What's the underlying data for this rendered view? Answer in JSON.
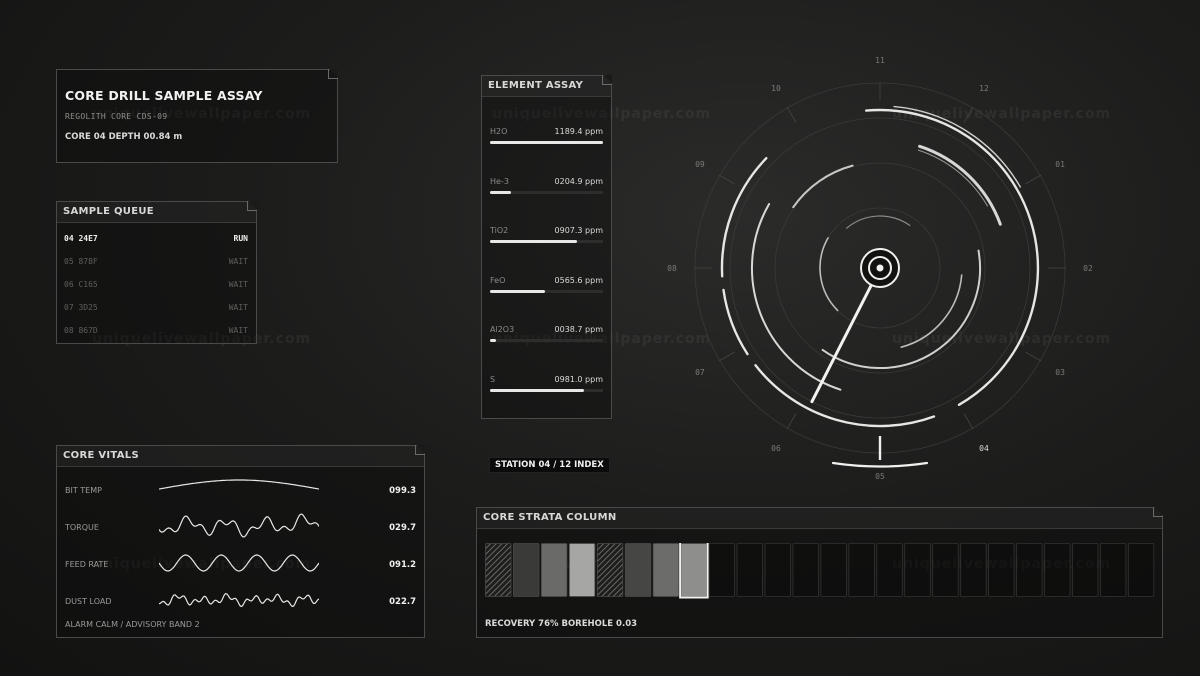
{
  "title_panel": {
    "title": "CORE DRILL SAMPLE ASSAY",
    "subtitle": "REGOLITH CORE  CDS-09",
    "core_line": "CORE 04  DEPTH 00.84 m"
  },
  "sample_queue": {
    "header": "SAMPLE QUEUE",
    "items": [
      {
        "id": "04  24E7",
        "status": "RUN",
        "active": true
      },
      {
        "id": "05  878F",
        "status": "WAIT",
        "active": false
      },
      {
        "id": "06  C165",
        "status": "WAIT",
        "active": false
      },
      {
        "id": "07  3D25",
        "status": "WAIT",
        "active": false
      },
      {
        "id": "08  867D",
        "status": "WAIT",
        "active": false
      }
    ]
  },
  "core_vitals": {
    "header": "CORE VITALS",
    "rows": [
      {
        "label": "BIT TEMP",
        "value": "099.3",
        "wave": "smooth"
      },
      {
        "label": "TORQUE",
        "value": "029.7",
        "wave": "noisy"
      },
      {
        "label": "FEED RATE",
        "value": "091.2",
        "wave": "sine"
      },
      {
        "label": "DUST LOAD",
        "value": "022.7",
        "wave": "jitter"
      }
    ],
    "alarm": "ALARM  CALM / ADVISORY BAND 2"
  },
  "element_assay": {
    "header": "ELEMENT ASSAY",
    "rows": [
      {
        "element": "H2O",
        "amount": "1189.4 ppm",
        "level": 1.0
      },
      {
        "element": "He-3",
        "amount": "0204.9 ppm",
        "level": 0.19
      },
      {
        "element": "TiO2",
        "amount": "0907.3 ppm",
        "level": 0.77
      },
      {
        "element": "FeO",
        "amount": "0565.6 ppm",
        "level": 0.49
      },
      {
        "element": "Al2O3",
        "amount": "0038.7 ppm",
        "level": 0.05
      },
      {
        "element": "S",
        "amount": "0981.0 ppm",
        "level": 0.83
      }
    ]
  },
  "station_label": "STATION 04 / 12  INDEX",
  "dial": {
    "ticks": [
      "10",
      "11",
      "12",
      "01",
      "02",
      "03",
      "04",
      "05",
      "06",
      "07",
      "08",
      "09"
    ],
    "active_station": "04"
  },
  "strata": {
    "header": "CORE STRATA COLUMN",
    "footer": "RECOVERY 76%  BOREHOLE 0.03",
    "cells": [
      {
        "fill": "hatch"
      },
      {
        "fill": "#3a3a39"
      },
      {
        "fill": "#6a6a68"
      },
      {
        "fill": "#a6a6a4"
      },
      {
        "fill": "hatch"
      },
      {
        "fill": "#464645"
      },
      {
        "fill": "#6c6c6a"
      },
      {
        "fill": "#8e8e8c",
        "selected": true
      },
      {
        "fill": "empty"
      },
      {
        "fill": "empty"
      },
      {
        "fill": "empty"
      },
      {
        "fill": "empty"
      },
      {
        "fill": "empty"
      },
      {
        "fill": "empty"
      },
      {
        "fill": "empty"
      },
      {
        "fill": "empty"
      },
      {
        "fill": "empty"
      },
      {
        "fill": "empty"
      },
      {
        "fill": "empty"
      },
      {
        "fill": "empty"
      },
      {
        "fill": "empty"
      },
      {
        "fill": "empty"
      },
      {
        "fill": "empty"
      },
      {
        "fill": "empty"
      }
    ]
  },
  "watermark": "uniquelivewallpaper.com"
}
